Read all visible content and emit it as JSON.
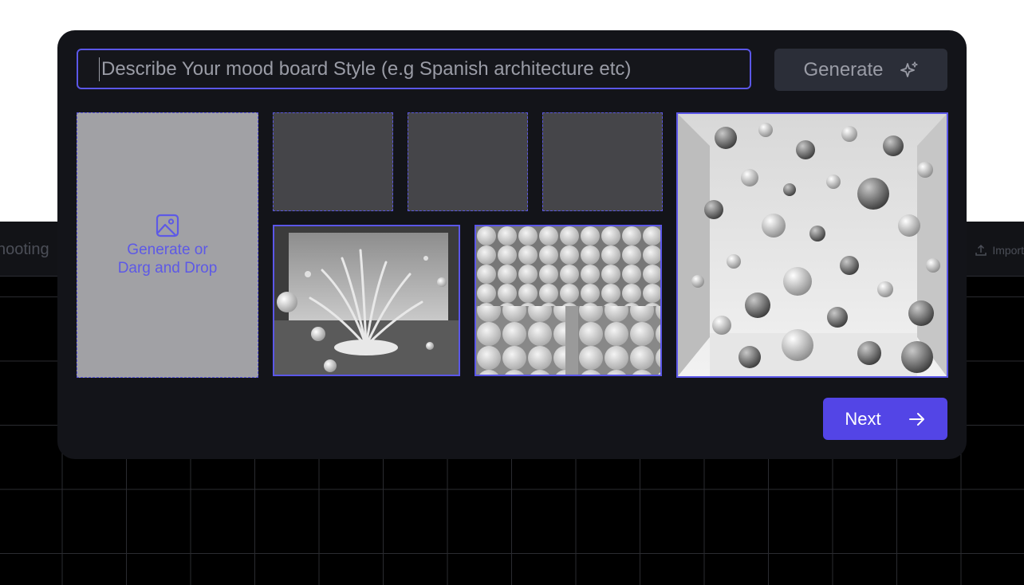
{
  "background": {
    "tab_label": "hooting",
    "import_label": "Import"
  },
  "modal": {
    "prompt_placeholder": "Describe Your mood board Style (e.g Spanish architecture etc)",
    "generate_label": "Generate",
    "upload_line1": "Generate or",
    "upload_line2": "Darg and Drop",
    "next_label": "Next"
  },
  "colors": {
    "accent": "#5b57e8",
    "button_primary": "#5345e6",
    "modal_bg": "#131419"
  },
  "icons": [
    "sparkle-icon",
    "image-icon",
    "arrow-right-icon",
    "upload-icon"
  ]
}
